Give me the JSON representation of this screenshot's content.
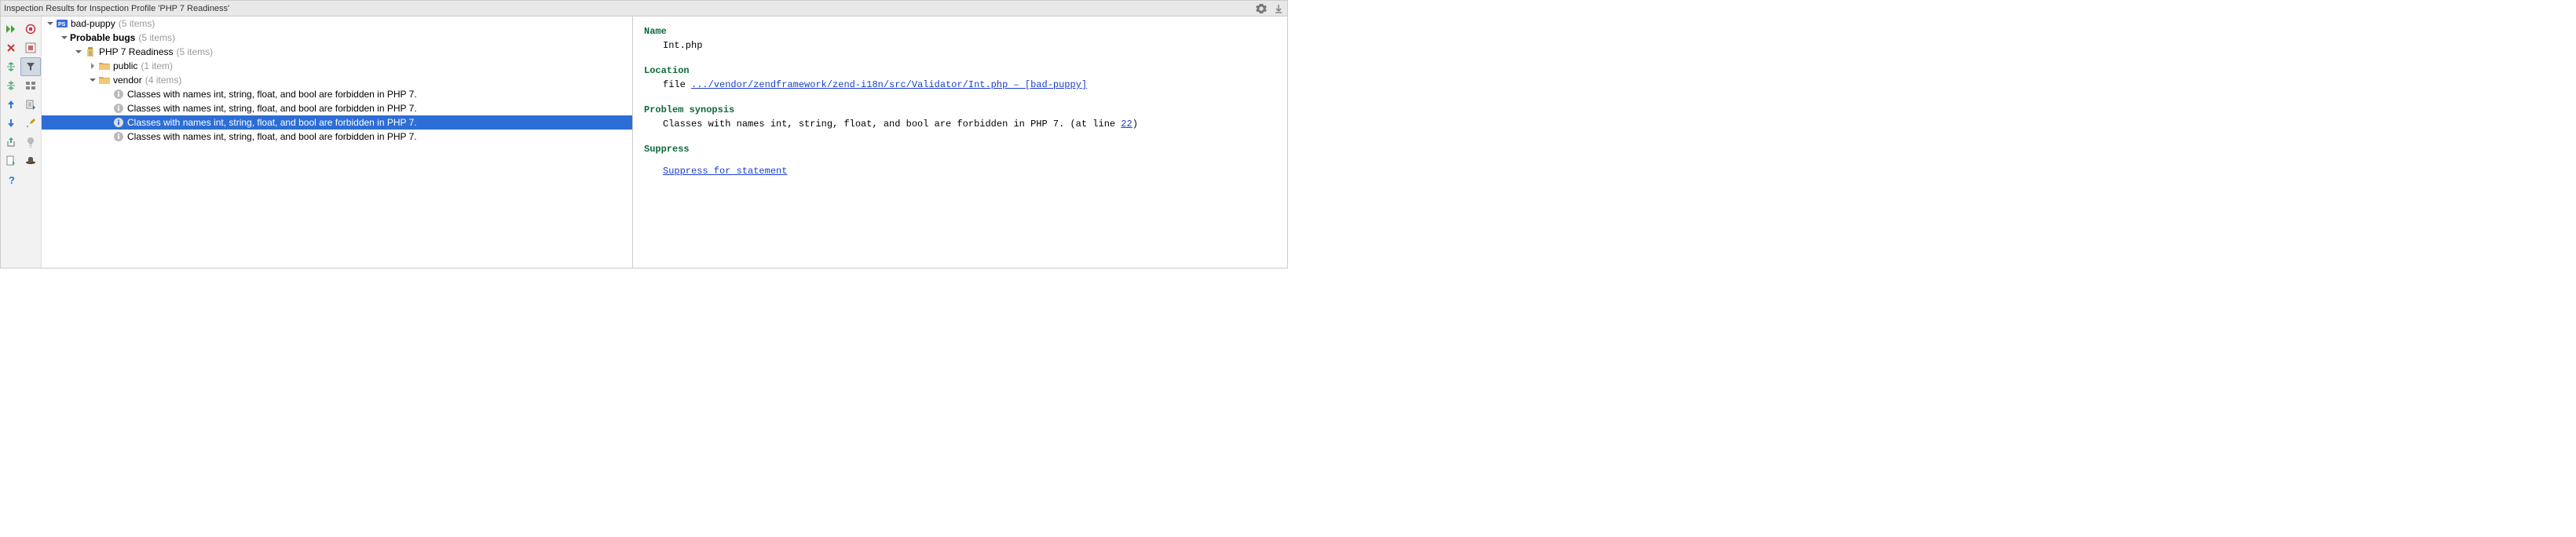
{
  "title": "Inspection Results for Inspection Profile 'PHP 7 Readiness'",
  "tree": {
    "root": {
      "label": "bad-puppy",
      "count": "(5 items)"
    },
    "probable_bugs": {
      "label": "Probable bugs",
      "count": "(5 items)"
    },
    "readiness": {
      "label": "PHP 7 Readiness",
      "count": "(5 items)"
    },
    "public": {
      "label": "public",
      "count": "(1 item)"
    },
    "vendor": {
      "label": "vendor",
      "count": "(4 items)"
    },
    "msg1": "Classes with names int, string, float, and bool are forbidden in PHP 7.",
    "msg2": "Classes with names int, string, float, and bool are forbidden in PHP 7.",
    "msg3": "Classes with names int, string, float, and bool are forbidden in PHP 7.",
    "msg4": "Classes with names int, string, float, and bool are forbidden in PHP 7."
  },
  "detail": {
    "name_h": "Name",
    "name_v": "Int.php",
    "loc_h": "Location",
    "loc_prefix": "file ",
    "loc_link": ".../vendor/zendframework/zend-i18n/src/Validator/Int.php – [bad-puppy]",
    "syn_h": "Problem synopsis",
    "syn_text": "Classes with names int, string, float, and bool are forbidden in PHP 7. (at line ",
    "syn_line": "22",
    "syn_close": ")",
    "sup_h": "Suppress",
    "sup_link": "Suppress for statement"
  }
}
